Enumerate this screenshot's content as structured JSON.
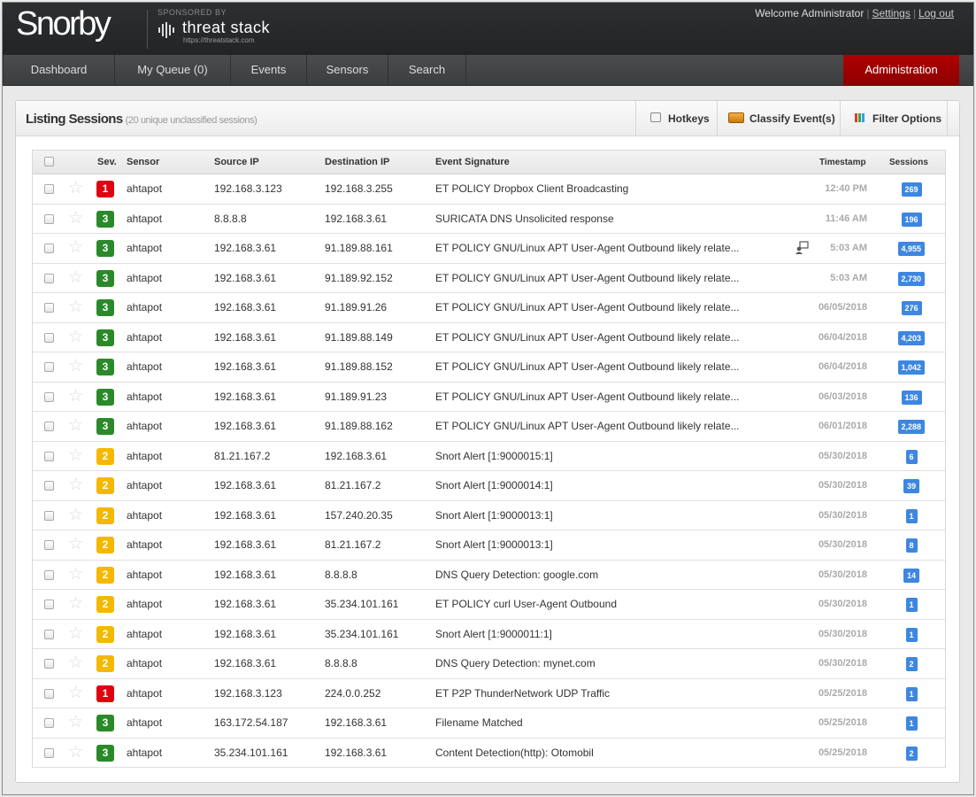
{
  "header": {
    "logo": "Snorby",
    "sponsor_label": "SPONSORED BY",
    "sponsor_name": "threat stack",
    "sponsor_url": "https://threatstack.com",
    "welcome": "Welcome Administrator",
    "settings": "Settings",
    "logout": "Log out"
  },
  "nav": {
    "items": [
      "Dashboard",
      "My Queue (0)",
      "Events",
      "Sensors",
      "Search"
    ],
    "admin": "Administration"
  },
  "panel": {
    "title": "Listing Sessions",
    "subtitle": "(20 unique unclassified sessions)",
    "tools": {
      "hotkeys": "Hotkeys",
      "classify": "Classify Event(s)",
      "filter": "Filter Options"
    }
  },
  "table": {
    "headers": {
      "sev": "Sev.",
      "sensor": "Sensor",
      "source": "Source IP",
      "destination": "Destination IP",
      "signature": "Event Signature",
      "timestamp": "Timestamp",
      "sessions": "Sessions"
    },
    "severity_colors": {
      "1": "#e0000f",
      "2": "#f5b800",
      "3": "#2a8a2a"
    },
    "rows": [
      {
        "sev": "1",
        "sensor": "ahtapot",
        "src": "192.168.3.123",
        "dst": "192.168.3.255",
        "sig": "ET POLICY Dropbox Client Broadcasting",
        "ts": "12:40 PM",
        "sessions": "269",
        "note": false
      },
      {
        "sev": "3",
        "sensor": "ahtapot",
        "src": "8.8.8.8",
        "dst": "192.168.3.61",
        "sig": "SURICATA DNS Unsolicited response",
        "ts": "11:46 AM",
        "sessions": "196",
        "note": false
      },
      {
        "sev": "3",
        "sensor": "ahtapot",
        "src": "192.168.3.61",
        "dst": "91.189.88.161",
        "sig": "ET POLICY GNU/Linux APT User-Agent Outbound likely relate...",
        "ts": "5:03 AM",
        "sessions": "4,955",
        "note": true
      },
      {
        "sev": "3",
        "sensor": "ahtapot",
        "src": "192.168.3.61",
        "dst": "91.189.92.152",
        "sig": "ET POLICY GNU/Linux APT User-Agent Outbound likely relate...",
        "ts": "5:03 AM",
        "sessions": "2,730",
        "note": false
      },
      {
        "sev": "3",
        "sensor": "ahtapot",
        "src": "192.168.3.61",
        "dst": "91.189.91.26",
        "sig": "ET POLICY GNU/Linux APT User-Agent Outbound likely relate...",
        "ts": "06/05/2018",
        "sessions": "276",
        "note": false
      },
      {
        "sev": "3",
        "sensor": "ahtapot",
        "src": "192.168.3.61",
        "dst": "91.189.88.149",
        "sig": "ET POLICY GNU/Linux APT User-Agent Outbound likely relate...",
        "ts": "06/04/2018",
        "sessions": "4,203",
        "note": false
      },
      {
        "sev": "3",
        "sensor": "ahtapot",
        "src": "192.168.3.61",
        "dst": "91.189.88.152",
        "sig": "ET POLICY GNU/Linux APT User-Agent Outbound likely relate...",
        "ts": "06/04/2018",
        "sessions": "1,042",
        "note": false
      },
      {
        "sev": "3",
        "sensor": "ahtapot",
        "src": "192.168.3.61",
        "dst": "91.189.91.23",
        "sig": "ET POLICY GNU/Linux APT User-Agent Outbound likely relate...",
        "ts": "06/03/2018",
        "sessions": "136",
        "note": false
      },
      {
        "sev": "3",
        "sensor": "ahtapot",
        "src": "192.168.3.61",
        "dst": "91.189.88.162",
        "sig": "ET POLICY GNU/Linux APT User-Agent Outbound likely relate...",
        "ts": "06/01/2018",
        "sessions": "2,288",
        "note": false
      },
      {
        "sev": "2",
        "sensor": "ahtapot",
        "src": "81.21.167.2",
        "dst": "192.168.3.61",
        "sig": "Snort Alert [1:9000015:1]",
        "ts": "05/30/2018",
        "sessions": "6",
        "note": false
      },
      {
        "sev": "2",
        "sensor": "ahtapot",
        "src": "192.168.3.61",
        "dst": "81.21.167.2",
        "sig": "Snort Alert [1:9000014:1]",
        "ts": "05/30/2018",
        "sessions": "39",
        "note": false
      },
      {
        "sev": "2",
        "sensor": "ahtapot",
        "src": "192.168.3.61",
        "dst": "157.240.20.35",
        "sig": "Snort Alert [1:9000013:1]",
        "ts": "05/30/2018",
        "sessions": "1",
        "note": false
      },
      {
        "sev": "2",
        "sensor": "ahtapot",
        "src": "192.168.3.61",
        "dst": "81.21.167.2",
        "sig": "Snort Alert [1:9000013:1]",
        "ts": "05/30/2018",
        "sessions": "8",
        "note": false
      },
      {
        "sev": "2",
        "sensor": "ahtapot",
        "src": "192.168.3.61",
        "dst": "8.8.8.8",
        "sig": "DNS Query Detection: google.com",
        "ts": "05/30/2018",
        "sessions": "14",
        "note": false
      },
      {
        "sev": "2",
        "sensor": "ahtapot",
        "src": "192.168.3.61",
        "dst": "35.234.101.161",
        "sig": "ET POLICY curl User-Agent Outbound",
        "ts": "05/30/2018",
        "sessions": "1",
        "note": false
      },
      {
        "sev": "2",
        "sensor": "ahtapot",
        "src": "192.168.3.61",
        "dst": "35.234.101.161",
        "sig": "Snort Alert [1:9000011:1]",
        "ts": "05/30/2018",
        "sessions": "1",
        "note": false
      },
      {
        "sev": "2",
        "sensor": "ahtapot",
        "src": "192.168.3.61",
        "dst": "8.8.8.8",
        "sig": "DNS Query Detection: mynet.com",
        "ts": "05/30/2018",
        "sessions": "2",
        "note": false
      },
      {
        "sev": "1",
        "sensor": "ahtapot",
        "src": "192.168.3.123",
        "dst": "224.0.0.252",
        "sig": "ET P2P ThunderNetwork UDP Traffic",
        "ts": "05/25/2018",
        "sessions": "1",
        "note": false
      },
      {
        "sev": "3",
        "sensor": "ahtapot",
        "src": "163.172.54.187",
        "dst": "192.168.3.61",
        "sig": "Filename Matched",
        "ts": "05/25/2018",
        "sessions": "1",
        "note": false
      },
      {
        "sev": "3",
        "sensor": "ahtapot",
        "src": "35.234.101.161",
        "dst": "192.168.3.61",
        "sig": "Content Detection(http): Otomobil",
        "ts": "05/25/2018",
        "sessions": "2",
        "note": false
      }
    ]
  }
}
